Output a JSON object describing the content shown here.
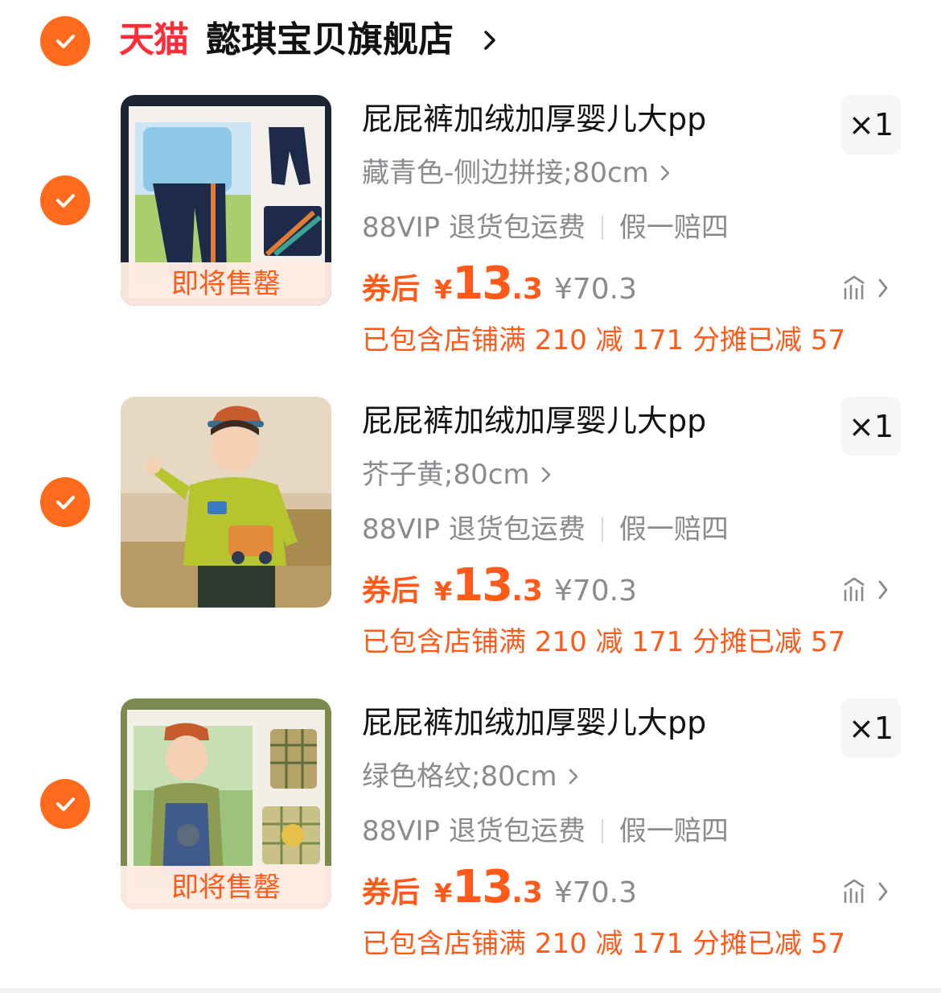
{
  "store": {
    "selected": true,
    "brand_logo_text": "天猫",
    "name": "懿琪宝贝旗舰店"
  },
  "items": [
    {
      "selected": true,
      "title": "屁屁裤加绒加厚婴儿大pp",
      "quantity": "×1",
      "sku": "藏青色-侧边拼接;80cm",
      "services": [
        "88VIP 退货包运费",
        "假一赔四"
      ],
      "price_label": "券后",
      "currency": "¥",
      "price_integer": "13",
      "price_decimal": ".3",
      "original_price": "¥70.3",
      "promo": "已包含店铺满 210 减 171 分摊已减 57",
      "badge": "即将售罄"
    },
    {
      "selected": true,
      "title": "屁屁裤加绒加厚婴儿大pp",
      "quantity": "×1",
      "sku": "芥子黄;80cm",
      "services": [
        "88VIP 退货包运费",
        "假一赔四"
      ],
      "price_label": "券后",
      "currency": "¥",
      "price_integer": "13",
      "price_decimal": ".3",
      "original_price": "¥70.3",
      "promo": "已包含店铺满 210 减 171 分摊已减 57",
      "badge": ""
    },
    {
      "selected": true,
      "title": "屁屁裤加绒加厚婴儿大pp",
      "quantity": "×1",
      "sku": "绿色格纹;80cm",
      "services": [
        "88VIP 退货包运费",
        "假一赔四"
      ],
      "price_label": "券后",
      "currency": "¥",
      "price_integer": "13",
      "price_decimal": ".3",
      "original_price": "¥70.3",
      "promo": "已包含店铺满 210 减 171 分摊已减 57",
      "badge": "即将售罄"
    }
  ],
  "colors": {
    "accent": "#ff6a1c",
    "price": "#ff5a1a",
    "tmall": "#ff2d3a",
    "muted": "#8a8a8f"
  }
}
